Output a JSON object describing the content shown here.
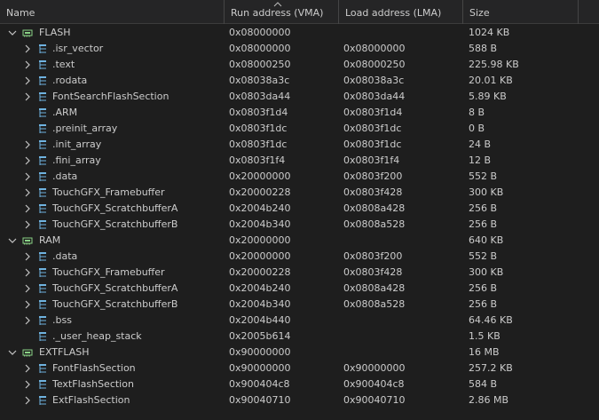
{
  "columns": {
    "name": "Name",
    "run": "Run address (VMA)",
    "load": "Load address (LMA)",
    "size": "Size"
  },
  "rows": [
    {
      "level": 0,
      "expanded": true,
      "icon": "memory-chip-icon",
      "name": "FLASH",
      "run": "0x08000000",
      "load": "",
      "size": "1024 KB"
    },
    {
      "level": 1,
      "expanded": false,
      "icon": "section-tree-icon",
      "name": ".isr_vector",
      "run": "0x08000000",
      "load": "0x08000000",
      "size": "588 B"
    },
    {
      "level": 1,
      "expanded": false,
      "icon": "section-tree-icon",
      "name": ".text",
      "run": "0x08000250",
      "load": "0x08000250",
      "size": "225.98 KB"
    },
    {
      "level": 1,
      "expanded": false,
      "icon": "section-tree-icon",
      "name": ".rodata",
      "run": "0x08038a3c",
      "load": "0x08038a3c",
      "size": "20.01 KB"
    },
    {
      "level": 1,
      "expanded": false,
      "icon": "section-tree-icon",
      "name": "FontSearchFlashSection",
      "run": "0x0803da44",
      "load": "0x0803da44",
      "size": "5.89 KB"
    },
    {
      "level": 1,
      "expanded": null,
      "icon": "section-tree-icon",
      "name": ".ARM",
      "run": "0x0803f1d4",
      "load": "0x0803f1d4",
      "size": "8 B"
    },
    {
      "level": 1,
      "expanded": null,
      "icon": "section-tree-icon",
      "name": ".preinit_array",
      "run": "0x0803f1dc",
      "load": "0x0803f1dc",
      "size": "0 B"
    },
    {
      "level": 1,
      "expanded": false,
      "icon": "section-tree-icon",
      "name": ".init_array",
      "run": "0x0803f1dc",
      "load": "0x0803f1dc",
      "size": "24 B"
    },
    {
      "level": 1,
      "expanded": false,
      "icon": "section-tree-icon",
      "name": ".fini_array",
      "run": "0x0803f1f4",
      "load": "0x0803f1f4",
      "size": "12 B"
    },
    {
      "level": 1,
      "expanded": false,
      "icon": "section-tree-icon",
      "name": ".data",
      "run": "0x20000000",
      "load": "0x0803f200",
      "size": "552 B"
    },
    {
      "level": 1,
      "expanded": false,
      "icon": "section-tree-icon",
      "name": "TouchGFX_Framebuffer",
      "run": "0x20000228",
      "load": "0x0803f428",
      "size": "300 KB"
    },
    {
      "level": 1,
      "expanded": false,
      "icon": "section-tree-icon",
      "name": "TouchGFX_ScratchbufferA",
      "run": "0x2004b240",
      "load": "0x0808a428",
      "size": "256 B"
    },
    {
      "level": 1,
      "expanded": false,
      "icon": "section-tree-icon",
      "name": "TouchGFX_ScratchbufferB",
      "run": "0x2004b340",
      "load": "0x0808a528",
      "size": "256 B"
    },
    {
      "level": 0,
      "expanded": true,
      "icon": "memory-chip-icon",
      "name": "RAM",
      "run": "0x20000000",
      "load": "",
      "size": "640 KB"
    },
    {
      "level": 1,
      "expanded": false,
      "icon": "section-tree-icon",
      "name": ".data",
      "run": "0x20000000",
      "load": "0x0803f200",
      "size": "552 B"
    },
    {
      "level": 1,
      "expanded": false,
      "icon": "section-tree-icon",
      "name": "TouchGFX_Framebuffer",
      "run": "0x20000228",
      "load": "0x0803f428",
      "size": "300 KB"
    },
    {
      "level": 1,
      "expanded": false,
      "icon": "section-tree-icon",
      "name": "TouchGFX_ScratchbufferA",
      "run": "0x2004b240",
      "load": "0x0808a428",
      "size": "256 B"
    },
    {
      "level": 1,
      "expanded": false,
      "icon": "section-tree-icon",
      "name": "TouchGFX_ScratchbufferB",
      "run": "0x2004b340",
      "load": "0x0808a528",
      "size": "256 B"
    },
    {
      "level": 1,
      "expanded": false,
      "icon": "section-tree-icon",
      "name": ".bss",
      "run": "0x2004b440",
      "load": "",
      "size": "64.46 KB"
    },
    {
      "level": 1,
      "expanded": null,
      "icon": "section-tree-icon",
      "name": "._user_heap_stack",
      "run": "0x2005b614",
      "load": "",
      "size": "1.5 KB"
    },
    {
      "level": 0,
      "expanded": true,
      "icon": "memory-chip-icon",
      "name": "EXTFLASH",
      "run": "0x90000000",
      "load": "",
      "size": "16 MB"
    },
    {
      "level": 1,
      "expanded": false,
      "icon": "section-tree-icon",
      "name": "FontFlashSection",
      "run": "0x90000000",
      "load": "0x90000000",
      "size": "257.2 KB"
    },
    {
      "level": 1,
      "expanded": false,
      "icon": "section-tree-icon",
      "name": "TextFlashSection",
      "run": "0x900404c8",
      "load": "0x900404c8",
      "size": "584 B"
    },
    {
      "level": 1,
      "expanded": false,
      "icon": "section-tree-icon",
      "name": "ExtFlashSection",
      "run": "0x90040710",
      "load": "0x90040710",
      "size": "2.86 MB"
    }
  ],
  "colors": {
    "background": "#1e1e1e",
    "header": "#252526",
    "text": "#cccccc",
    "icon": "#6fb3e0",
    "chip": "#89d185"
  }
}
